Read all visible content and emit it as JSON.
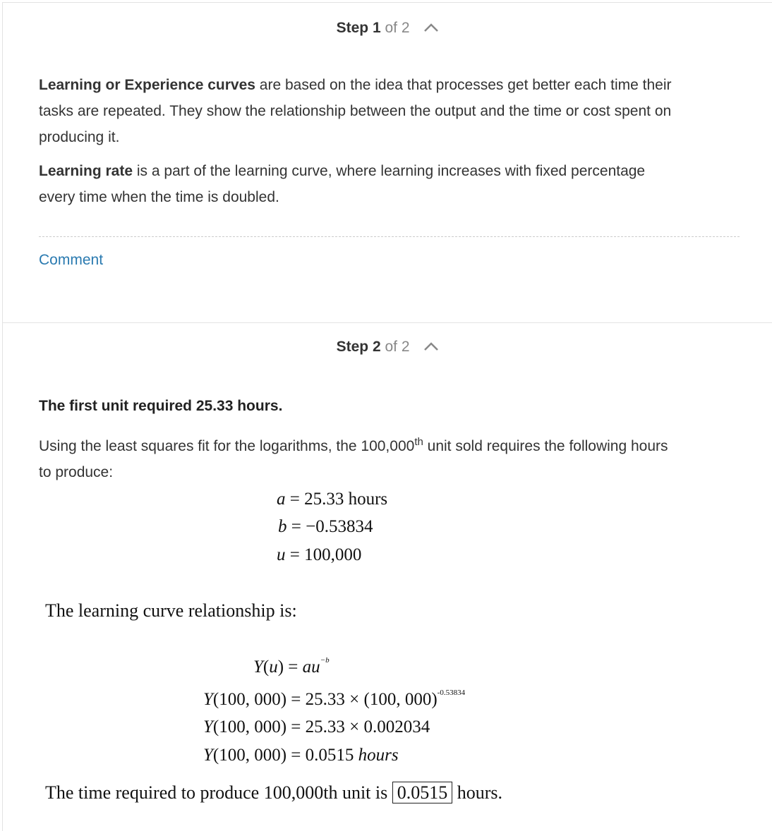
{
  "step1": {
    "header_word": "Step",
    "header_num": "1",
    "header_of": "of 2",
    "p1_bold": "Learning or Experience curves",
    "p1_line1_rest": " are based on the idea that processes get better each time their",
    "p1_line2": "tasks are repeated. They show the relationship between the output and the time or cost spent on",
    "p1_line3": "producing it.",
    "p2_bold": "Learning rate",
    "p2_line1_rest": " is a part of the learning curve, where learning increases with fixed percentage",
    "p2_line2": "every time when the time is doubled.",
    "comment_label": "Comment"
  },
  "step2": {
    "header_word": "Step",
    "header_num": "2",
    "header_of": "of 2",
    "first_unit": "The first unit required 25.33 hours.",
    "intro_pre": "Using the least squares fit for the logarithms, the 100,000",
    "intro_sup": "th",
    "intro_post": " unit sold requires the following hours",
    "intro_line2": "to produce:",
    "given": {
      "a_var": "a",
      "a_val": " = 25.33 hours",
      "b_var": "b",
      "b_val": " = −0.53834",
      "u_var": "u",
      "u_val": " = 100,000"
    },
    "relationship_label": "The learning curve relationship is:",
    "eq1_lhs": "Y",
    "eq1_mid": "(",
    "eq1_u": "u",
    "eq1_close": ") = ",
    "eq1_au": "au",
    "eq1_exp": "−b",
    "eq2_Y": "Y",
    "eq2_rest": "(100, 000) = 25.33 × (100, 000)",
    "eq2_exp": "-0.53834",
    "eq3_Y": "Y",
    "eq3_rest": "(100, 000) = 25.33 × 0.002034",
    "eq4_Y": "Y",
    "eq4_rest": "(100, 000) = 0.0515 ",
    "eq4_unit": "hours",
    "final_pre": "The time required to produce 100,000th unit is ",
    "final_box": "0.0515",
    "final_post": " hours."
  },
  "icons": {
    "collapse": "chevron-up-icon"
  }
}
